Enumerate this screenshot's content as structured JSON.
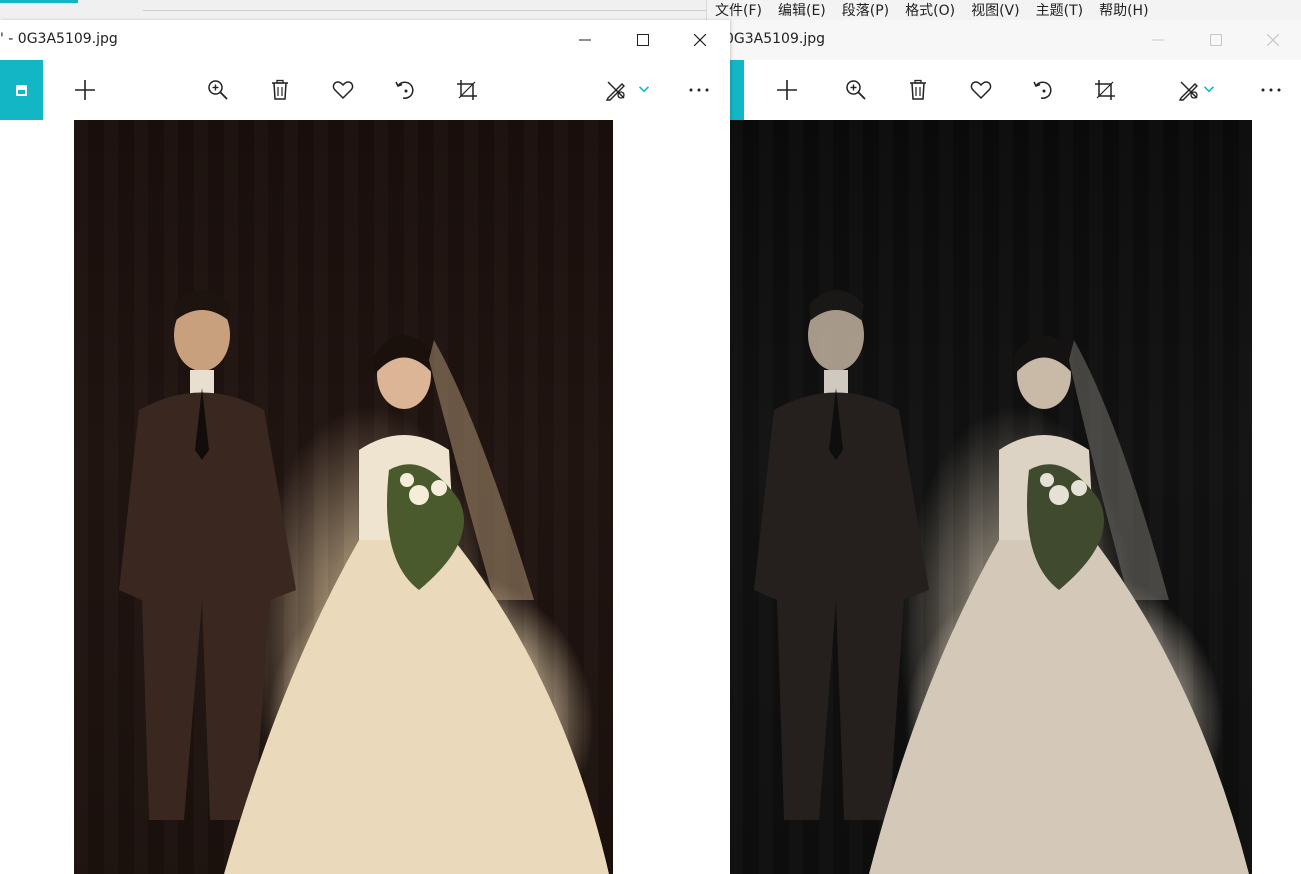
{
  "background_app": {
    "menu": [
      "文件(F)",
      "编辑(E)",
      "段落(P)",
      "格式(O)",
      "视图(V)",
      "主题(T)",
      "帮助(H)"
    ]
  },
  "viewer_left": {
    "title": "' - 0G3A5109.jpg",
    "toolbar": [
      "add-icon",
      "zoom-in-icon",
      "delete-icon",
      "favorite-icon",
      "rotate-icon",
      "crop-icon",
      "edit-icon",
      "more-icon"
    ]
  },
  "viewer_right": {
    "title": "0G3A5109.jpg",
    "toolbar": [
      "add-icon",
      "zoom-in-icon",
      "delete-icon",
      "favorite-icon",
      "rotate-icon",
      "crop-icon",
      "edit-icon",
      "more-icon"
    ]
  },
  "colors": {
    "accent": "#12b6c4",
    "photo_warm_bg": "#1a0f0c",
    "photo_cool_bg": "#0b0b0b"
  }
}
